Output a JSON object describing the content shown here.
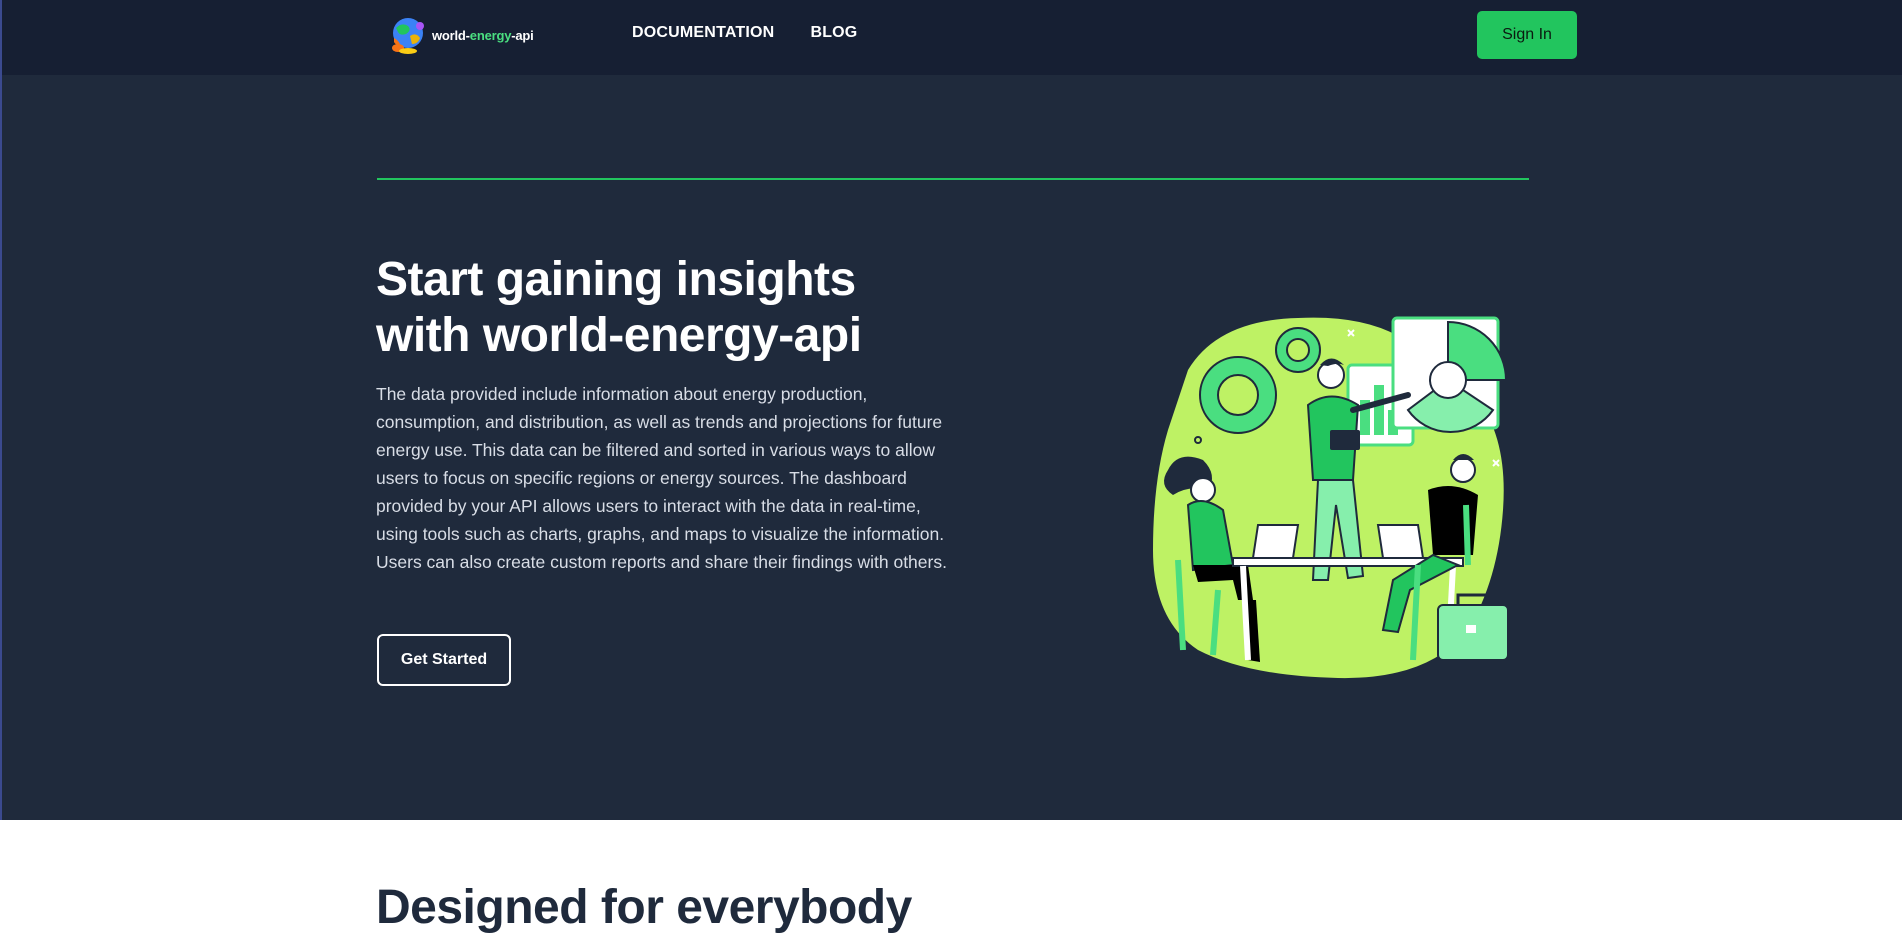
{
  "header": {
    "logo_text_prefix": "world-",
    "logo_text_accent": "energy",
    "logo_text_suffix": "-api",
    "logo_icon": "globe-logo-icon",
    "nav": [
      {
        "label": "DOCUMENTATION"
      },
      {
        "label": "BLOG"
      }
    ],
    "signin_label": "Sign In"
  },
  "hero": {
    "title_line1": "Start gaining insights",
    "title_line2": "with world-energy-api",
    "description": "The data provided include information about energy production, consumption, and distribution, as well as trends and projections for future energy use. This data can be filtered and sorted in various ways to allow users to focus on specific regions or energy sources. The dashboard provided by your API allows users to interact with the data in real-time, using tools such as charts, graphs, and maps to visualize the information. Users can also create custom reports and share their findings with others.",
    "cta_label": "Get Started",
    "illustration": "team-dashboard-illustration"
  },
  "section2": {
    "title": "Designed for everybody"
  },
  "colors": {
    "topbar_bg": "#161f33",
    "hero_bg": "#1f2a3c",
    "accent": "#22c55e",
    "illustration_lime": "#bef264",
    "illustration_green": "#4ade80"
  }
}
